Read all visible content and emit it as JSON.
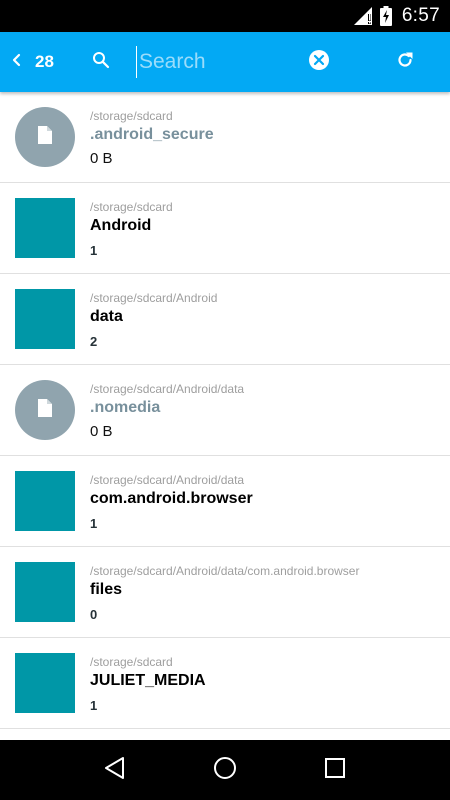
{
  "status_bar": {
    "time": "6:57",
    "icons": [
      "signal-icon",
      "battery-charging-icon"
    ]
  },
  "app_bar": {
    "back_icon": "chevron-left-icon",
    "count": "28",
    "search_icon": "search-icon",
    "search_placeholder": "Search",
    "search_value": "",
    "clear_icon": "clear-circle-icon",
    "refresh_icon": "refresh-icon",
    "color": "#03A9F4"
  },
  "files": [
    {
      "type": "file",
      "path": "/storage/sdcard",
      "name": ".android_secure",
      "detail": "0 B"
    },
    {
      "type": "folder",
      "path": "/storage/sdcard",
      "name": "Android",
      "detail": "1"
    },
    {
      "type": "folder",
      "path": "/storage/sdcard/Android",
      "name": "data",
      "detail": "2"
    },
    {
      "type": "file",
      "path": "/storage/sdcard/Android/data",
      "name": ".nomedia",
      "detail": "0 B"
    },
    {
      "type": "folder",
      "path": "/storage/sdcard/Android/data",
      "name": "com.android.browser",
      "detail": "1"
    },
    {
      "type": "folder",
      "path": "/storage/sdcard/Android/data/com.android.browser",
      "name": "files",
      "detail": "0"
    },
    {
      "type": "folder",
      "path": "/storage/sdcard",
      "name": "JULIET_MEDIA",
      "detail": "1"
    }
  ],
  "nav_bar": {
    "icons": [
      "back-nav-icon",
      "home-nav-icon",
      "recents-nav-icon"
    ]
  },
  "colors": {
    "folder": "#0097A7",
    "file_circle": "#90A4AE",
    "hidden_name": "#78909C"
  }
}
